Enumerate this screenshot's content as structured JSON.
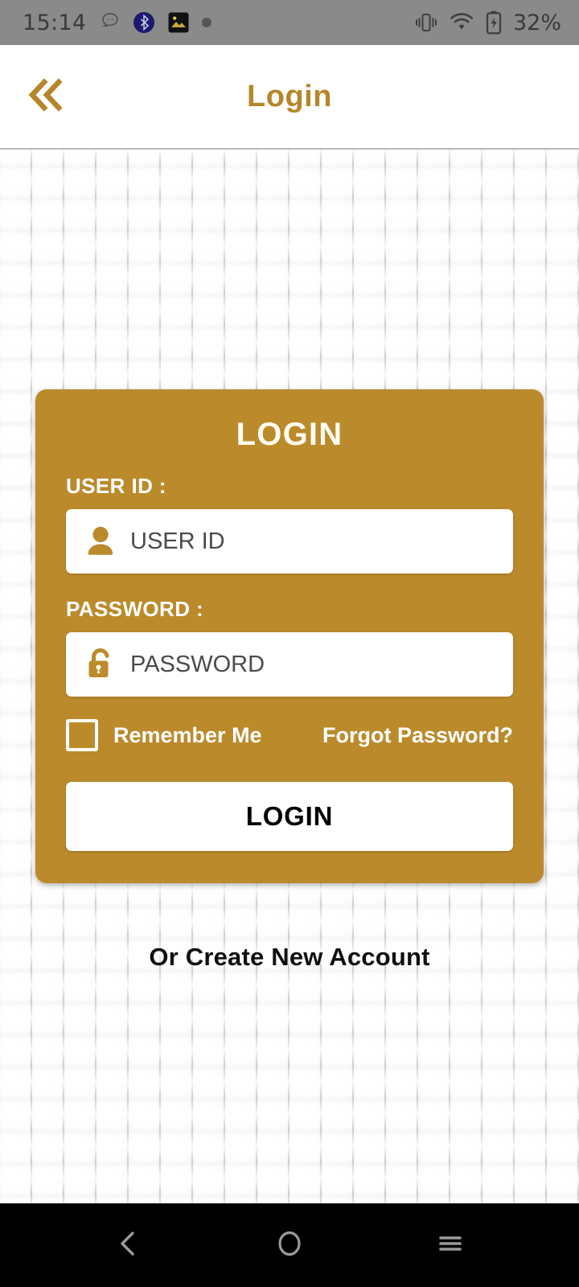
{
  "status_bar": {
    "time": "15:14",
    "battery_percent": "32%",
    "icons_left": [
      "messaging-app-icon",
      "bluetooth-badge-icon",
      "photo-app-icon",
      "notification-dot-icon"
    ],
    "icons_right": [
      "vibrate-icon",
      "wifi-icon",
      "battery-charging-icon"
    ],
    "background_color": "#8a8a8a"
  },
  "header": {
    "title": "Login",
    "back_icon": "double-chevron-left-icon",
    "accent_color": "#b5862a"
  },
  "card": {
    "title": "LOGIN",
    "background_color": "#bb8a2b",
    "user": {
      "label": "USER ID :",
      "placeholder": "USER ID",
      "value": "",
      "icon": "person-icon"
    },
    "password": {
      "label": "PASSWORD :",
      "placeholder": "PASSWORD",
      "value": "",
      "icon": "unlock-icon"
    },
    "remember_me": {
      "label": "Remember Me",
      "checked": false
    },
    "forgot_password": "Forgot Password?",
    "submit_label": "LOGIN"
  },
  "footer": {
    "create_account": "Or Create New Account"
  },
  "nav_bar": {
    "back": "back-chevron-icon",
    "home": "home-circle-icon",
    "recents": "recents-menu-icon",
    "background_color": "#000000"
  }
}
